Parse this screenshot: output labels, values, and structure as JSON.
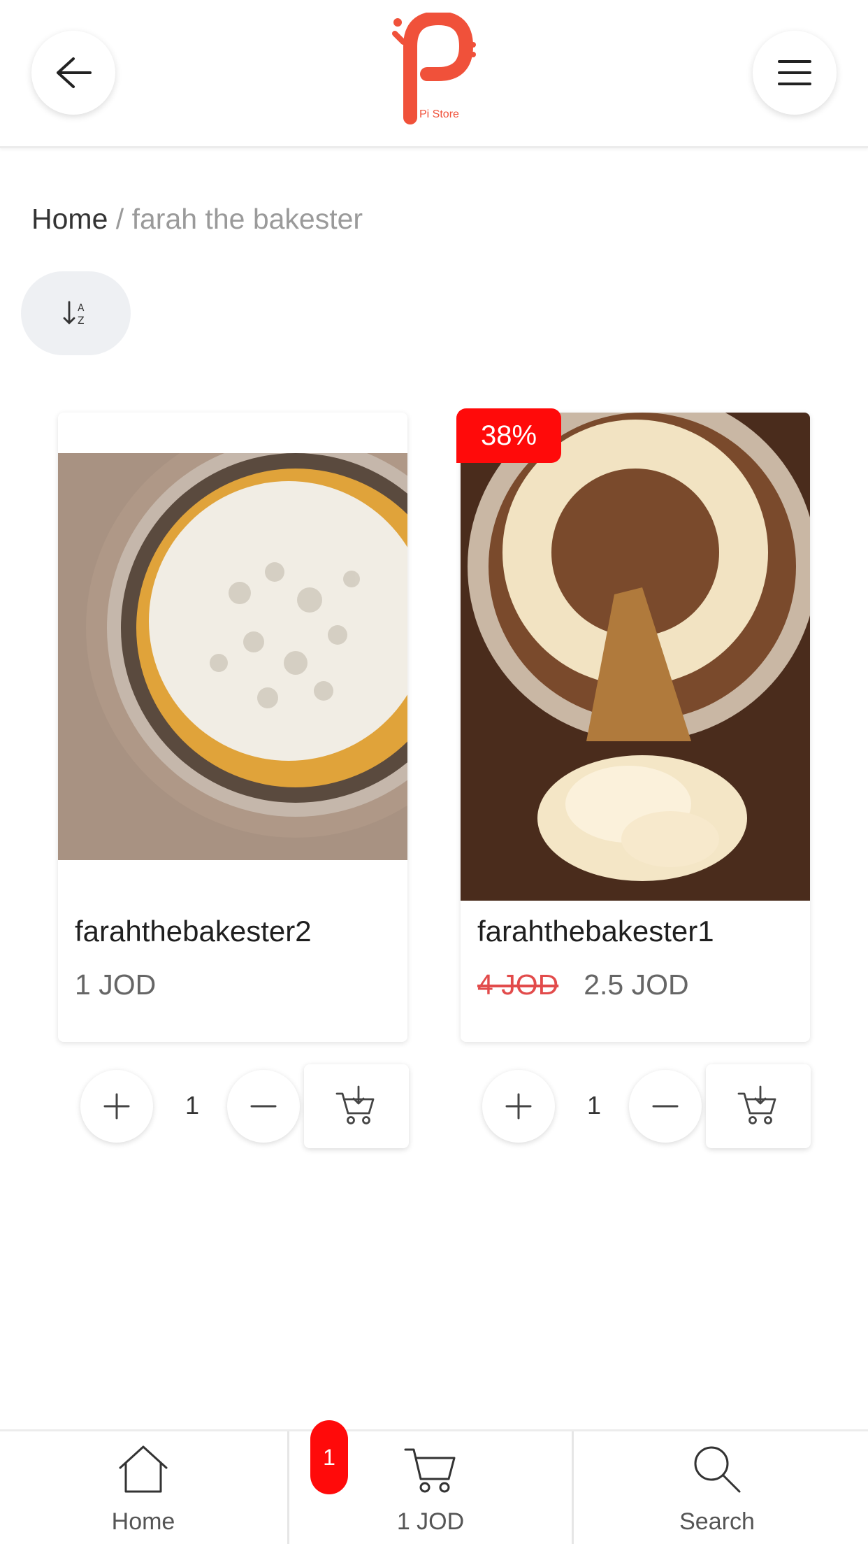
{
  "header": {
    "back_icon": "arrow-left-icon",
    "menu_icon": "hamburger-menu-icon",
    "logo_text": "Pi Store",
    "brand_color": "#f0513a"
  },
  "breadcrumb": {
    "home": "Home",
    "separator": "/",
    "current": "farah the bakester"
  },
  "sort_button": {
    "icon": "sort-a-z-icon"
  },
  "products": [
    {
      "name": "farahthebakester2",
      "price": "1 JOD",
      "quantity": "1",
      "image": "cheesecake-with-whipped-cream"
    },
    {
      "name": "farahthebakester1",
      "old_price": "4 JOD",
      "price": "2.5 JOD",
      "discount": "38%",
      "quantity": "1",
      "image": "carrot-cake-slice"
    }
  ],
  "bottom_nav": {
    "home_label": "Home",
    "cart_label": "1 JOD",
    "cart_count": "1",
    "search_label": "Search"
  },
  "colors": {
    "accent_red": "#ff0a0a",
    "strike_price": "#e24b4b"
  }
}
